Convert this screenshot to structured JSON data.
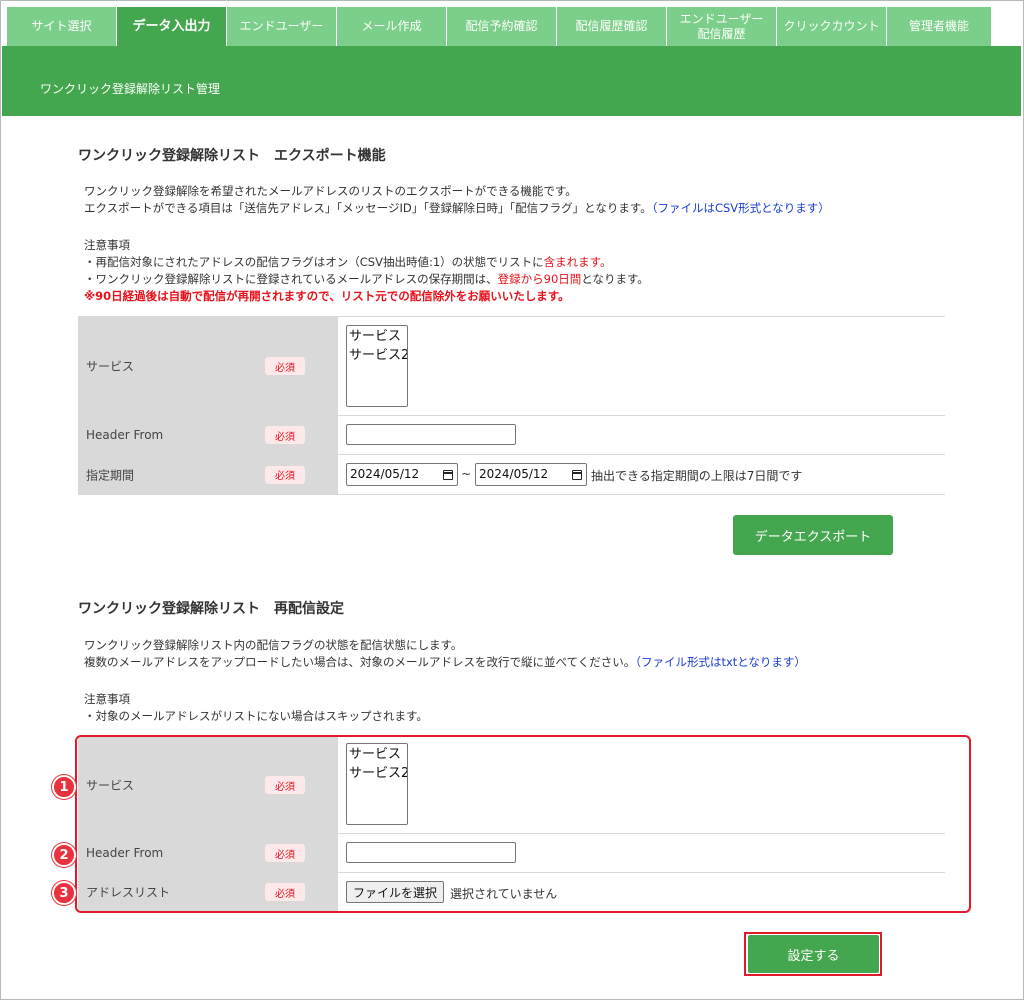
{
  "nav": {
    "tabs": [
      {
        "label": "サイト選択"
      },
      {
        "label": "データ入出力"
      },
      {
        "label": "エンドユーザー"
      },
      {
        "label": "メール作成"
      },
      {
        "label": "配信予約確認"
      },
      {
        "label": "配信履歴確認"
      },
      {
        "label": "エンドユーザー\n配信履歴"
      },
      {
        "label": "クリックカウント"
      },
      {
        "label": "管理者機能"
      }
    ],
    "active_index": 1
  },
  "page": {
    "subtitle": "ワンクリック登録解除リスト管理"
  },
  "export": {
    "heading": "ワンクリック登録解除リスト　エクスポート機能",
    "desc_line1": "ワンクリック登録解除を希望されたメールアドレスのリストのエクスポートができる機能です。",
    "desc_line2": "エクスポートができる項目は「送信先アドレス」「メッセージID」「登録解除日時」「配信フラグ」となります。",
    "desc_line2_link": "（ファイルはCSV形式となります）",
    "notes_title": "注意事項",
    "note1_a": "・再配信対象にされたアドレスの配信フラグはオン（CSV抽出時値:1）の状態でリストに",
    "note1_b": "含まれます。",
    "note2_a": "・ワンクリック登録解除リストに登録されているメールアドレスの保存期間は、",
    "note2_b": "登録から90日間",
    "note2_c": "となります。",
    "warning": "※90日経過後は自動で配信が再開されますので、リスト元での配信除外をお願いいたします。",
    "service_label": "サービス",
    "required_label": "必須",
    "service_options": [
      "サービス",
      "サービス2"
    ],
    "header_from_label": "Header From",
    "period_label": "指定期間",
    "date_from": "2024/05/12",
    "date_to": "2024/05/12",
    "tilde": "~",
    "period_note": "抽出できる指定期間の上限は7日間です",
    "button": "データエクスポート"
  },
  "resend": {
    "heading": "ワンクリック登録解除リスト　再配信設定",
    "desc_line1": "ワンクリック登録解除リスト内の配信フラグの状態を配信状態にします。",
    "desc_line2": "複数のメールアドレスをアップロードしたい場合は、対象のメールアドレスを改行で縦に並べてください。",
    "desc_line2_link": "（ファイル形式はtxtとなります）",
    "notes_title": "注意事項",
    "note1": "・対象のメールアドレスがリストにない場合はスキップされます。",
    "service_label": "サービス",
    "required_label": "必須",
    "service_options": [
      "サービス",
      "サービス2"
    ],
    "header_from_label": "Header From",
    "address_list_label": "アドレスリスト",
    "file_button": "ファイルを選択",
    "file_status": "選択されていません",
    "button": "設定する",
    "badges": [
      "1",
      "2",
      "3"
    ]
  },
  "colors": {
    "accent": "#44a64f",
    "tab": "#7ccf8a",
    "highlight": "#e01a2a",
    "link": "#1a3bd6"
  }
}
